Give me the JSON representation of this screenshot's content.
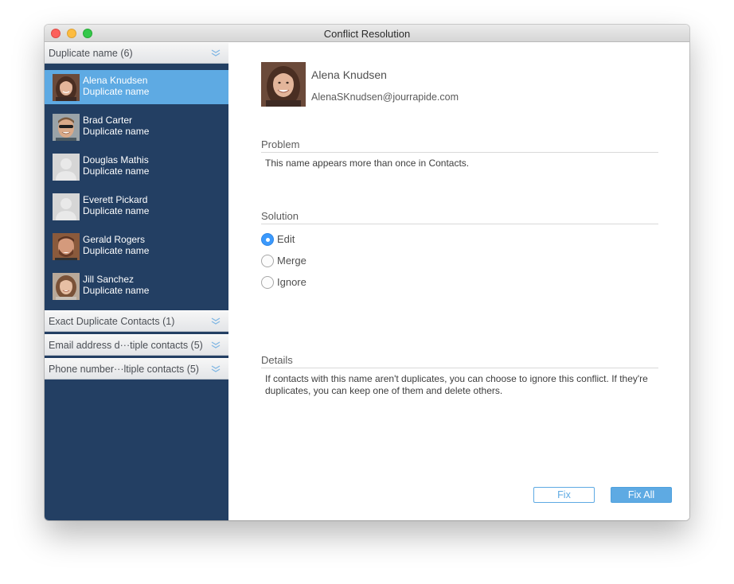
{
  "window": {
    "title": "Conflict Resolution"
  },
  "sidebar": {
    "groups": [
      {
        "label": "Duplicate name (6)"
      },
      {
        "label": "Exact Duplicate Contacts (1)"
      },
      {
        "label": "Email address d···tiple contacts (5)"
      },
      {
        "label": "Phone number···ltiple contacts (5)"
      }
    ],
    "contacts": [
      {
        "name": "Alena Knudsen",
        "subtitle": "Duplicate name",
        "avatar": "woman-photo-1"
      },
      {
        "name": "Brad Carter",
        "subtitle": "Duplicate name",
        "avatar": "man-sunglasses-photo"
      },
      {
        "name": "Douglas Mathis",
        "subtitle": "Duplicate name",
        "avatar": "placeholder-silhouette"
      },
      {
        "name": "Everett Pickard",
        "subtitle": "Duplicate name",
        "avatar": "placeholder-silhouette"
      },
      {
        "name": "Gerald Rogers",
        "subtitle": "Duplicate name",
        "avatar": "man-beard-photo"
      },
      {
        "name": "Jill Sanchez",
        "subtitle": "Duplicate name",
        "avatar": "woman-photo-2"
      }
    ]
  },
  "detail": {
    "name": "Alena Knudsen",
    "email": "AlenaSKnudsen@jourrapide.com",
    "problem": {
      "title": "Problem",
      "text": "This name appears more than once in Contacts."
    },
    "solution": {
      "title": "Solution",
      "options": [
        {
          "label": "Edit",
          "checked": true
        },
        {
          "label": "Merge",
          "checked": false
        },
        {
          "label": "Ignore",
          "checked": false
        }
      ]
    },
    "details": {
      "title": "Details",
      "text": "If contacts with this name aren't duplicates, you can choose to ignore this conflict. If they're duplicates, you can keep one of them and delete others."
    }
  },
  "buttons": {
    "fix": "Fix",
    "fix_all": "Fix All"
  },
  "colors": {
    "sidebar_bg": "#233f63",
    "selection": "#5eaae3",
    "accent": "#5eaae3",
    "radio_checked": "#3b99fc"
  }
}
